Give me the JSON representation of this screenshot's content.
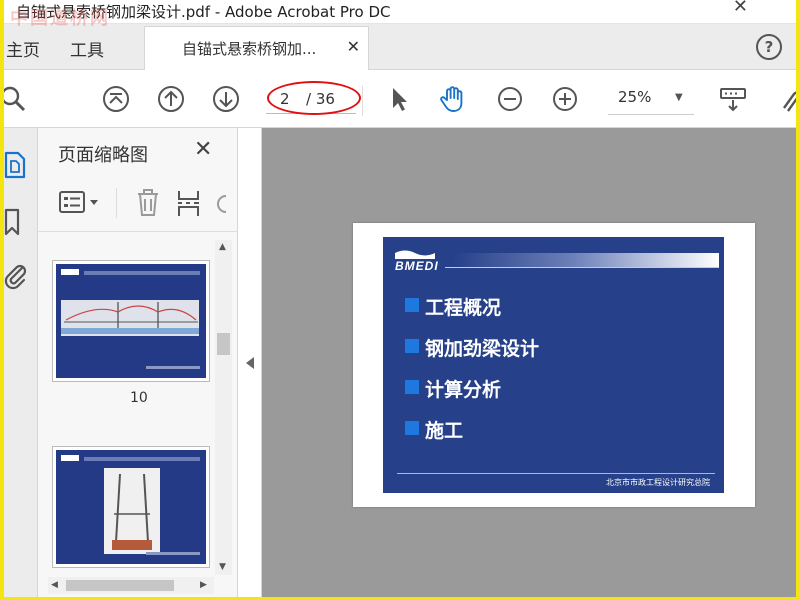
{
  "window": {
    "title": "自锚式悬索桥钢加梁设计.pdf - Adobe Acrobat Pro DC",
    "close_glyph": "✕"
  },
  "tabs": {
    "home": "主页",
    "tools": "工具",
    "document": "自锚式悬索桥钢加...",
    "document_close": "✕",
    "help": "?"
  },
  "toolbar": {
    "current_page": "2",
    "total_pages": "/ 36",
    "zoom": "25%",
    "zoom_arrow": "▼"
  },
  "panel": {
    "title": "页面缩略图",
    "close": "✕",
    "thumbnails": [
      {
        "label": "10"
      },
      {
        "label": ""
      }
    ]
  },
  "slide": {
    "logo": "BMEDI",
    "bullets": [
      "工程概况",
      "钢加劲梁设计",
      "计算分析",
      "施工"
    ],
    "footer": "北京市市政工程设计研究总院"
  },
  "watermark": "中国道桥网",
  "colors": {
    "slide_bg": "#26418a",
    "bullet": "#1e78e0",
    "annotation": "#e01010",
    "accent_icon": "#1a73c8"
  }
}
